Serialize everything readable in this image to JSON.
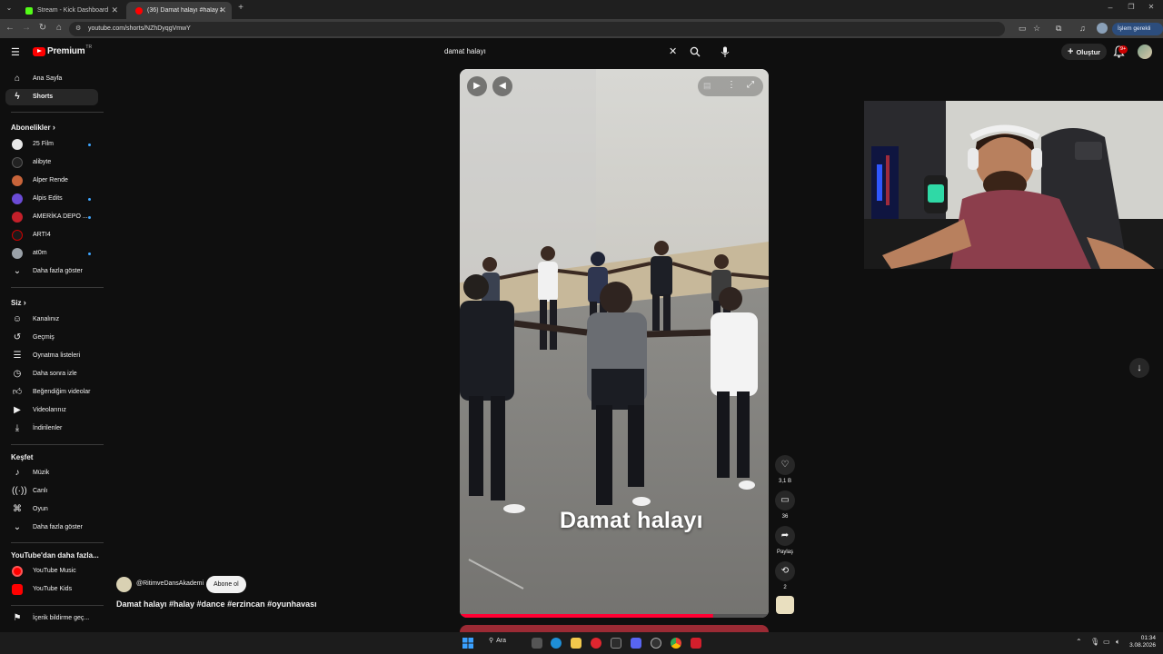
{
  "browser": {
    "tabs": [
      {
        "title": "Stream - Kick Dashboard",
        "favicon_color": "#53fc18"
      },
      {
        "title": "(36) Damat halayı #halay #dance",
        "favicon_color": "#ff0000"
      }
    ],
    "url": "youtube.com/shorts/NZhDyqgVmwY",
    "error_button": "İşlem gerekli"
  },
  "header": {
    "logo_text": "Premium",
    "country_code": "TR",
    "search_value": "damat halayı",
    "create_label": "Oluştur",
    "notification_count": "9+"
  },
  "sidebar": {
    "main": [
      {
        "label": "Ana Sayfa",
        "icon": "home-icon"
      },
      {
        "label": "Shorts",
        "icon": "shorts-icon"
      }
    ],
    "subscriptions_title": "Abonelikler",
    "subscriptions": [
      {
        "label": "25 Film",
        "avatar_color": "#e7e7e7",
        "new": true
      },
      {
        "label": "alibyte",
        "avatar_color": "#222222",
        "new": false
      },
      {
        "label": "Alper Rende",
        "avatar_color": "#c8643a",
        "new": false
      },
      {
        "label": "Alpis Edits",
        "avatar_color": "#6b4bd6",
        "new": true
      },
      {
        "label": "AMERİKA DEPO ...",
        "avatar_color": "#c4202a",
        "new": true
      },
      {
        "label": "ARTI4",
        "avatar_color": "#1a1a1a",
        "new": false
      },
      {
        "label": "at0m",
        "avatar_color": "#9aa1a8",
        "new": true
      }
    ],
    "show_more_1": "Daha fazla göster",
    "you_title": "Siz",
    "you_items": [
      {
        "label": "Kanalınız",
        "icon": "user-icon"
      },
      {
        "label": "Geçmiş",
        "icon": "history-icon"
      },
      {
        "label": "Oynatma listeleri",
        "icon": "playlist-icon"
      },
      {
        "label": "Daha sonra izle",
        "icon": "clock-icon"
      },
      {
        "label": "Beğendiğim videolar",
        "icon": "thumb-up-icon"
      },
      {
        "label": "Videolarınız",
        "icon": "video-icon"
      },
      {
        "label": "İndirilenler",
        "icon": "download-icon"
      }
    ],
    "explore_title": "Keşfet",
    "explore_items": [
      {
        "label": "Müzik",
        "icon": "music-icon"
      },
      {
        "label": "Canlı",
        "icon": "live-icon"
      },
      {
        "label": "Oyun",
        "icon": "gaming-icon"
      }
    ],
    "show_more_2": "Daha fazla göster",
    "more_title": "YouTube'dan daha fazla...",
    "more_items": [
      {
        "label": "YouTube Music",
        "icon": "youtube-music-icon"
      },
      {
        "label": "YouTube Kids",
        "icon": "youtube-kids-icon"
      }
    ],
    "report_label": "İçerik bildirme geç..."
  },
  "video": {
    "caption": "Damat halayı",
    "channel": "@RitimveDansAkademi",
    "subscribe_label": "Abone ol",
    "title": "Damat halayı #halay #dance #erzincan #oyunhavası",
    "progress": 0.82
  },
  "actions": {
    "likes": "3,1 B",
    "comments": "36",
    "share": "Paylaş",
    "remix": "2"
  },
  "taskbar": {
    "search_label": "Ara",
    "time": "01:34",
    "date": "3.08.2026"
  }
}
